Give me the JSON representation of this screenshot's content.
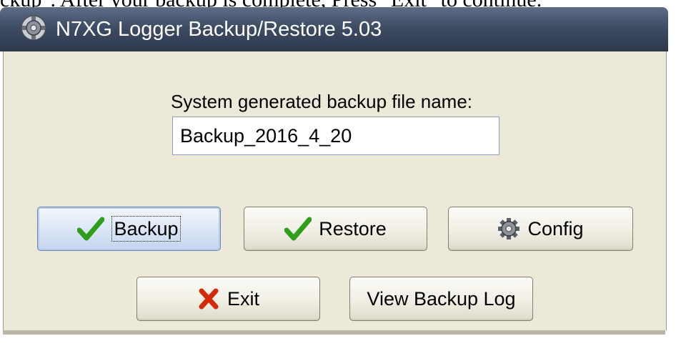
{
  "document": {
    "top_text": "ckup\". After your backup is complete, Press \"Exit\" to continue."
  },
  "window": {
    "title": "N7XG Logger Backup/Restore 5.03",
    "icon": "gear-app-icon"
  },
  "form": {
    "filename_label": "System generated backup file name:",
    "filename_value": "Backup_2016_4_20"
  },
  "buttons": {
    "backup": {
      "label": "Backup",
      "icon": "green-check-icon",
      "focused": true
    },
    "restore": {
      "label": "Restore",
      "icon": "green-check-icon"
    },
    "config": {
      "label": "Config",
      "icon": "gear-icon"
    },
    "exit": {
      "label": "Exit",
      "icon": "red-x-icon"
    },
    "view_log": {
      "label": "View Backup Log"
    }
  },
  "colors": {
    "titlebar": "#3e4c64",
    "client_bg": "#ece9d8",
    "check_green": "#2e9e1b",
    "exit_red": "#d42a0c",
    "focus_button": "#d9e5f6"
  }
}
